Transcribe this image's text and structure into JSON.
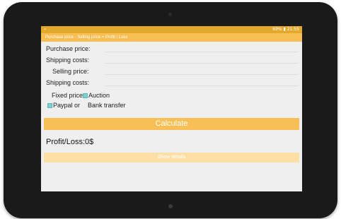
{
  "status_bar": {
    "left_icon": "notification-icon",
    "right_text": "69% ▮ 21:55"
  },
  "app_bar": {
    "title": "Purchase price - Selling price = Profit / Loss"
  },
  "form": {
    "purchase_price_label": "Purchase price:",
    "shipping_costs_label_1": "Shipping costs:",
    "selling_price_label": "Selling price:",
    "shipping_costs_label_2": "Shipping costs:",
    "fixed_price_label": "Fixed price",
    "auction_label": "Auction",
    "paypal_label": "Paypal or",
    "bank_transfer_label": "Bank transfer"
  },
  "actions": {
    "calculate_label": "Calculate",
    "show_details_label": "Show details"
  },
  "result": {
    "profit_loss_text": "Profit/Loss:0$"
  },
  "colors": {
    "status_bar": "#e3a92a",
    "app_bar": "#f6be53",
    "calculate_button": "#f7bf55",
    "details_button": "#fbdfa5",
    "checkbox": "#7fcfcf"
  }
}
